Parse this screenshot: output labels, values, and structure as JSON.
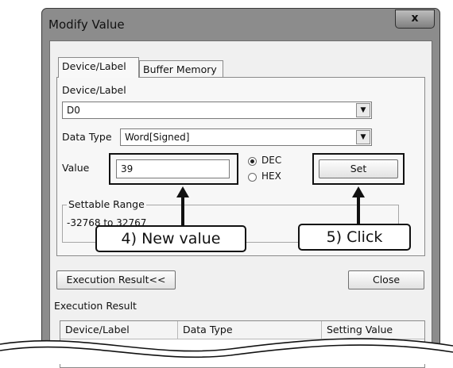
{
  "window": {
    "title": "Modify Value",
    "close_symbol": "x"
  },
  "tabs": [
    {
      "label": "Device/Label",
      "active": true
    },
    {
      "label": "Buffer Memory",
      "active": false
    }
  ],
  "device_label": {
    "caption": "Device/Label",
    "value": "D0",
    "arrow": "▼"
  },
  "data_type": {
    "caption": "Data Type",
    "value": "Word[Signed]",
    "arrow": "▼"
  },
  "value_field": {
    "caption": "Value",
    "value": "39"
  },
  "radix": {
    "dec_label": "DEC",
    "hex_label": "HEX",
    "selected": "DEC"
  },
  "set_button": {
    "label": "Set"
  },
  "settable_range": {
    "caption": "Settable Range",
    "text": "-32768 to 32767"
  },
  "annotations": {
    "new_value": "4) New value",
    "click": "5) Click"
  },
  "execution_result_button": {
    "label": "Execution Result<<"
  },
  "close_button": {
    "label": "Close"
  },
  "execution_result": {
    "caption": "Execution Result",
    "columns": [
      "Device/Label",
      "Data Type",
      "Setting Value"
    ]
  },
  "colors": {
    "window_frame": "#8c8c8c",
    "client_bg": "#f0f0f0",
    "highlight": "#111111"
  }
}
